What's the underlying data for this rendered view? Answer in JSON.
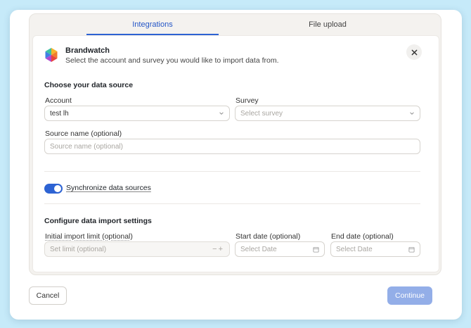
{
  "tabs": [
    {
      "label": "Integrations",
      "active": true
    },
    {
      "label": "File upload",
      "active": false
    }
  ],
  "header": {
    "title": "Brandwatch",
    "subtitle": "Select the account and survey you would like to import data from."
  },
  "data_source": {
    "section_title": "Choose your data source",
    "account": {
      "label": "Account",
      "value": "test lh"
    },
    "survey": {
      "label": "Survey",
      "placeholder": "Select survey"
    },
    "source_name": {
      "label": "Source name (optional)",
      "placeholder": "Source name (optional)"
    }
  },
  "sync": {
    "label": "Synchronize data sources",
    "enabled": true
  },
  "import_settings": {
    "section_title": "Configure data import settings",
    "limit": {
      "label": "Initial import limit (optional)",
      "placeholder": "Set limit (optional)",
      "minus": "−",
      "plus": "+"
    },
    "start_date": {
      "label": "Start date (optional)",
      "placeholder": "Select Date"
    },
    "end_date": {
      "label": "End date (optional)",
      "placeholder": "Select Date"
    }
  },
  "footer": {
    "cancel": "Cancel",
    "continue": "Continue"
  },
  "colors": {
    "accent": "#2d63d3",
    "continue_disabled": "#93aee8",
    "background": "#c6eaf9"
  },
  "icons": [
    "brandwatch-logo",
    "close-icon",
    "chevron-down-icon",
    "calendar-icon"
  ]
}
